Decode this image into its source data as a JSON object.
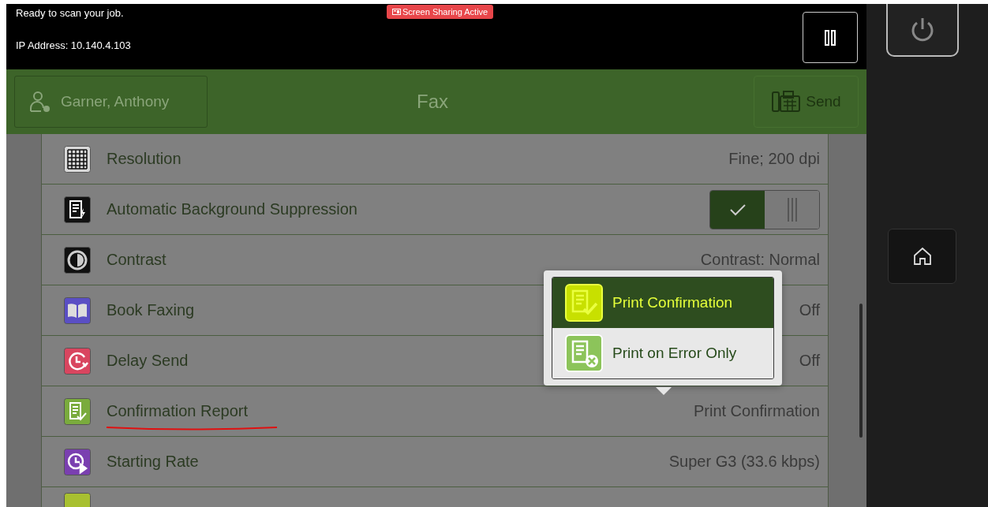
{
  "status_bar": {
    "message": "Ready to scan your job.",
    "ip_address": "IP Address: 10.140.4.103",
    "sharing_badge": "Screen Sharing Active"
  },
  "header": {
    "user": "Garner, Anthony",
    "title": "Fax",
    "send": {
      "label": "Send",
      "disabled": true
    }
  },
  "settings": [
    {
      "label": "Resolution",
      "kind": "value",
      "value": "Fine; 200 dpi",
      "color": "#d8d8d8"
    },
    {
      "label": "Automatic Background Suppression",
      "kind": "toggle",
      "on": true,
      "color": "#111111"
    },
    {
      "label": "Contrast",
      "kind": "value",
      "value": "Contrast: Normal",
      "color": "#111111"
    },
    {
      "label": "Book Faxing",
      "kind": "value",
      "value": "Off",
      "color": "#5a4fc4"
    },
    {
      "label": "Delay Send",
      "kind": "value",
      "value": "Off",
      "color": "#d9455f"
    },
    {
      "label": "Confirmation Report",
      "kind": "value",
      "value": "Print Confirmation",
      "color": "#7aab3d",
      "underlined": true
    },
    {
      "label": "Starting Rate",
      "kind": "value",
      "value": "Super G3 (33.6 kbps)",
      "color": "#7a3fb0"
    }
  ],
  "partial_row": {
    "color": "#a8c030"
  },
  "popup": {
    "options": [
      {
        "label": "Print Confirmation",
        "selected": true
      },
      {
        "label": "Print on Error Only",
        "selected": false
      }
    ]
  }
}
